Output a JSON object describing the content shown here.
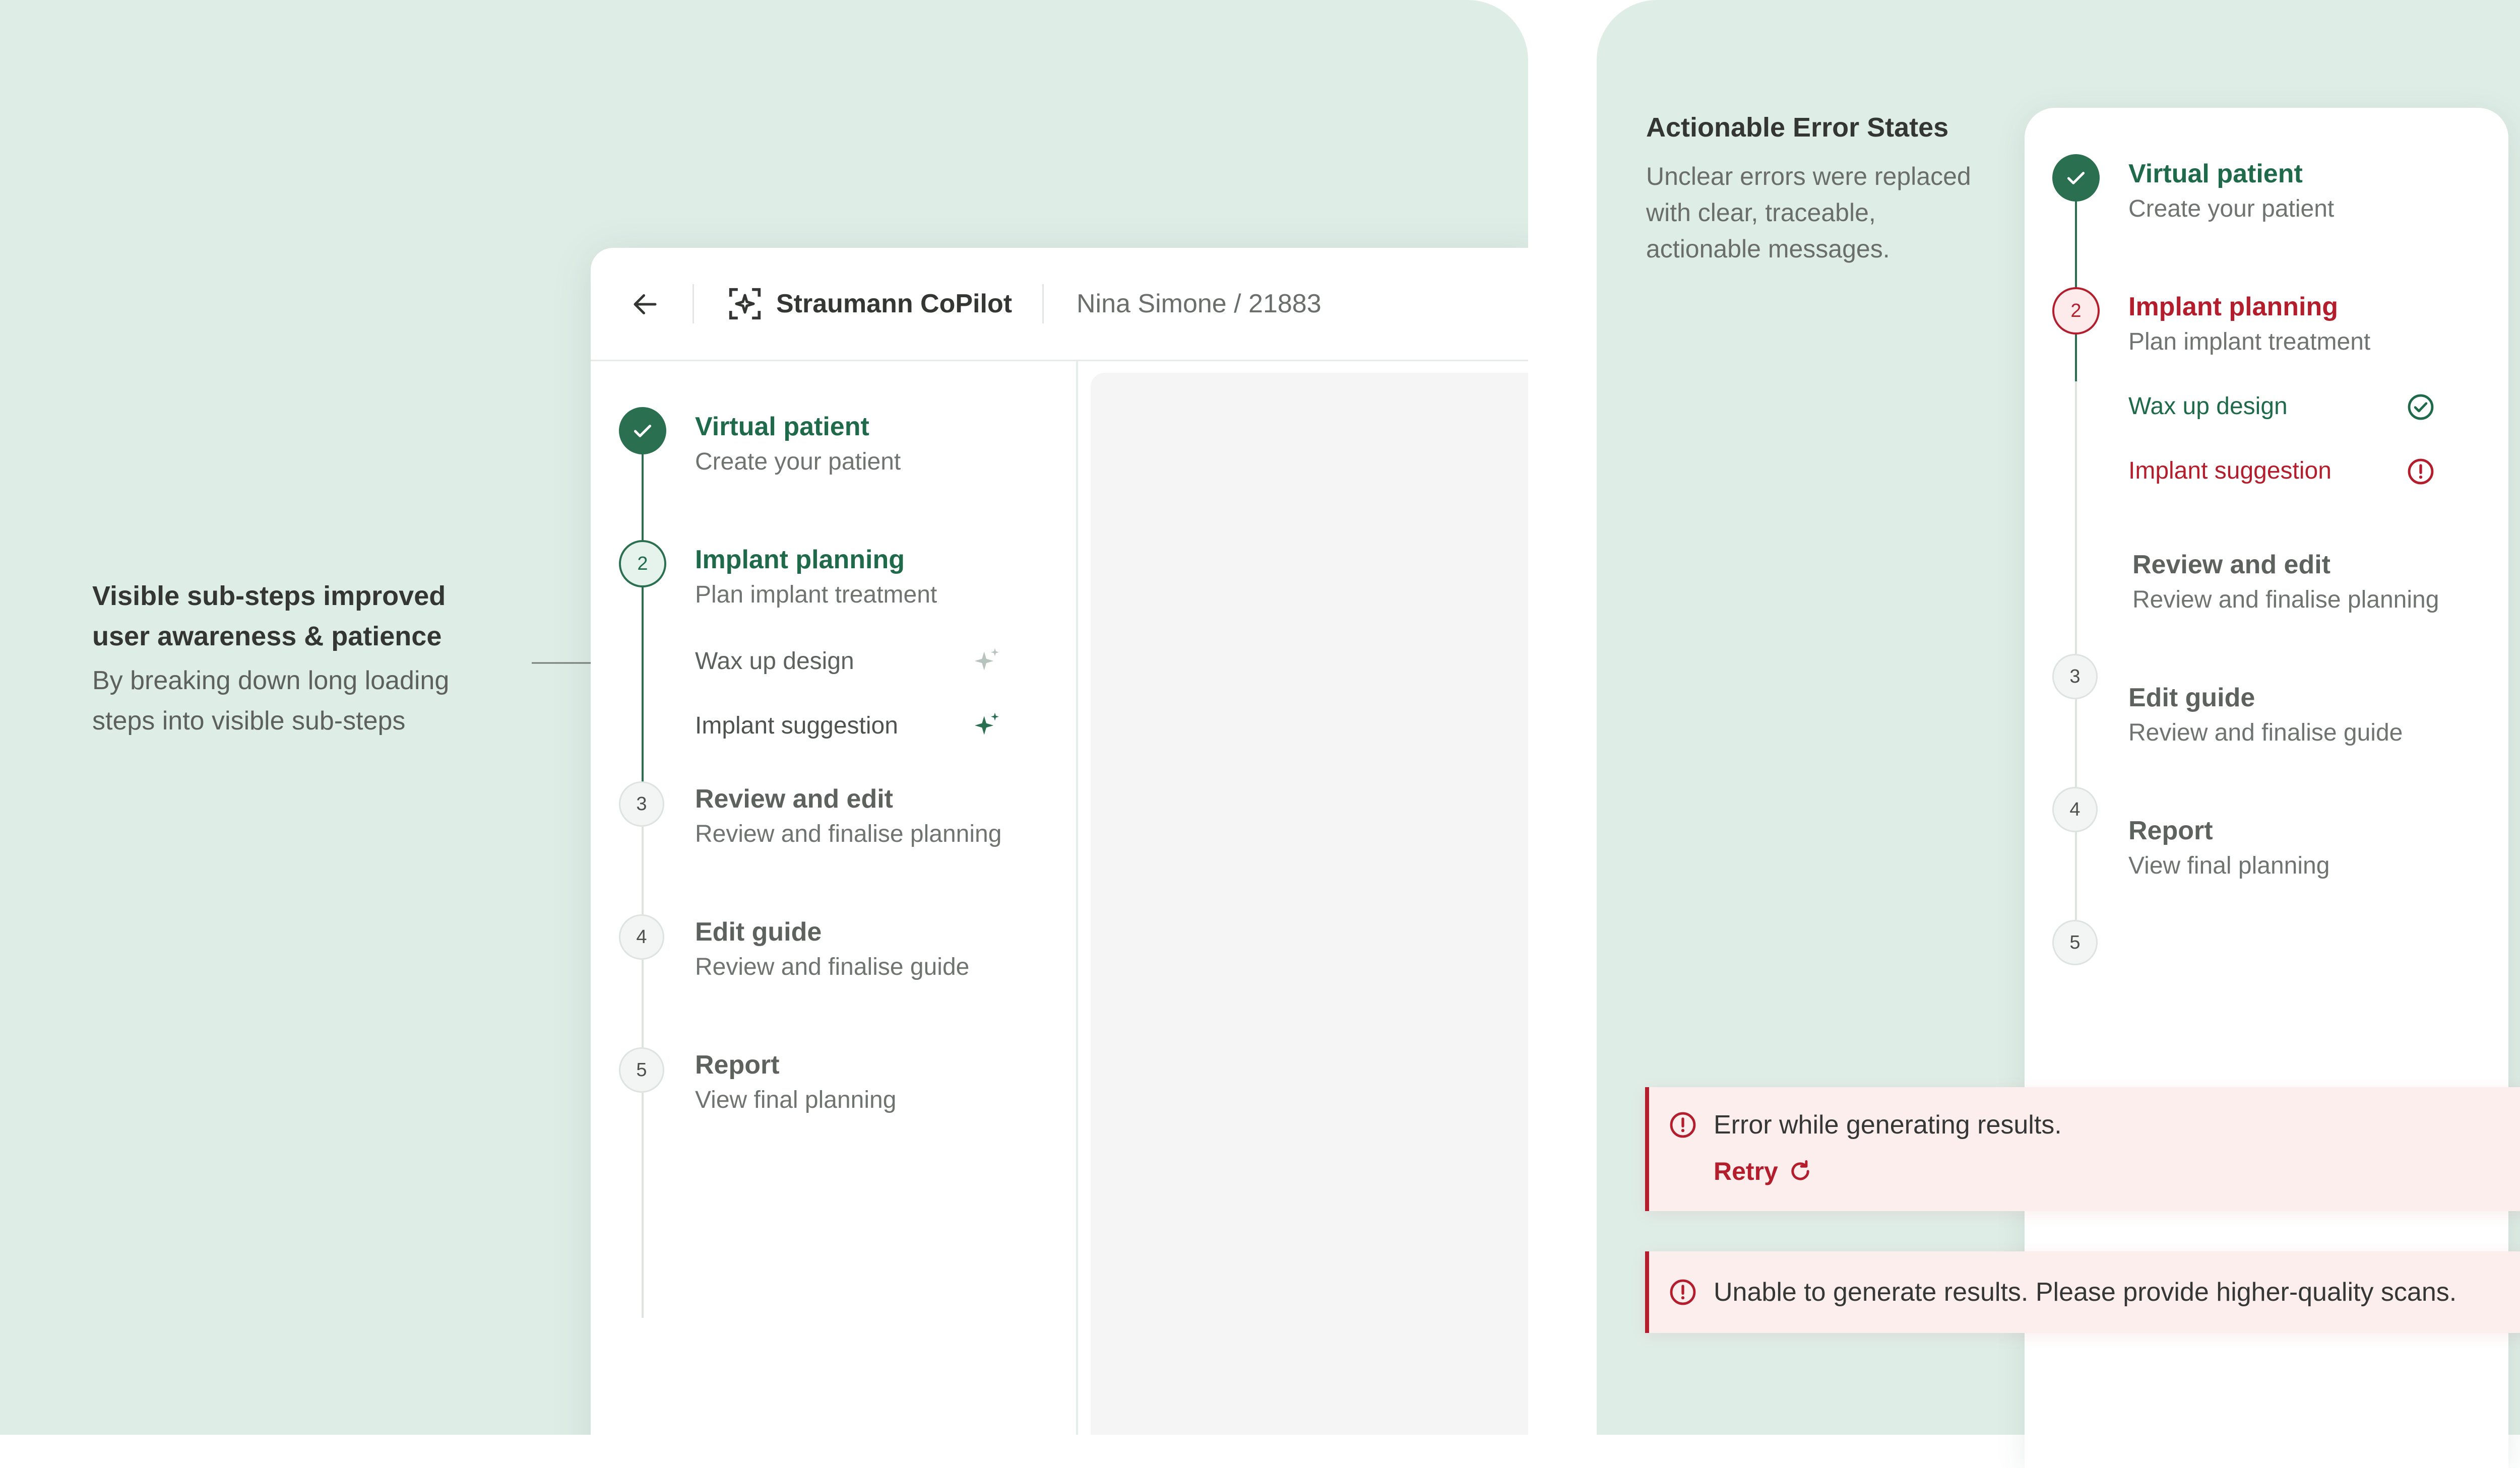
{
  "callout": {
    "title_line1": "Visible sub-steps improved",
    "title_line2": "user awareness & patience",
    "body_line1": "By breaking down long loading",
    "body_line2": "steps into visible sub-steps"
  },
  "app": {
    "brand": "Straumann CoPilot",
    "patient": "Nina Simone / 21883"
  },
  "steps": [
    {
      "num": "1",
      "title": "Virtual patient",
      "subtitle": "Create your patient"
    },
    {
      "num": "2",
      "title": "Implant planning",
      "subtitle": "Plan implant treatment"
    },
    {
      "num": "3",
      "title": "Review and edit",
      "subtitle": "Review and finalise planning"
    },
    {
      "num": "4",
      "title": "Edit guide",
      "subtitle": "Review and finalise guide"
    },
    {
      "num": "5",
      "title": "Report",
      "subtitle": "View final planning"
    }
  ],
  "substeps": [
    {
      "label": "Wax up design",
      "icon": "sparkle-icon",
      "status": "processing"
    },
    {
      "label": "Implant suggestion",
      "icon": "sparkle-icon",
      "status": "active"
    }
  ],
  "error_states": {
    "title": "Actionable Error States",
    "body_line1": "Unclear errors were replaced",
    "body_line2": "with clear, traceable,",
    "body_line3": "actionable messages.",
    "substeps": [
      {
        "label": "Wax up design",
        "status": "success",
        "icon": "check-circle-icon"
      },
      {
        "label": "Implant suggestion",
        "status": "error",
        "icon": "alert-circle-icon"
      }
    ],
    "banner1": {
      "message": "Error while generating results.",
      "action": "Retry"
    },
    "banner2": {
      "message": "Unable to generate results. Please provide higher-quality scans."
    }
  },
  "colors": {
    "background": "#dfede7",
    "primary_green": "#2a6f50",
    "error_red": "#b31d2c",
    "error_bg": "#fdeeee"
  }
}
